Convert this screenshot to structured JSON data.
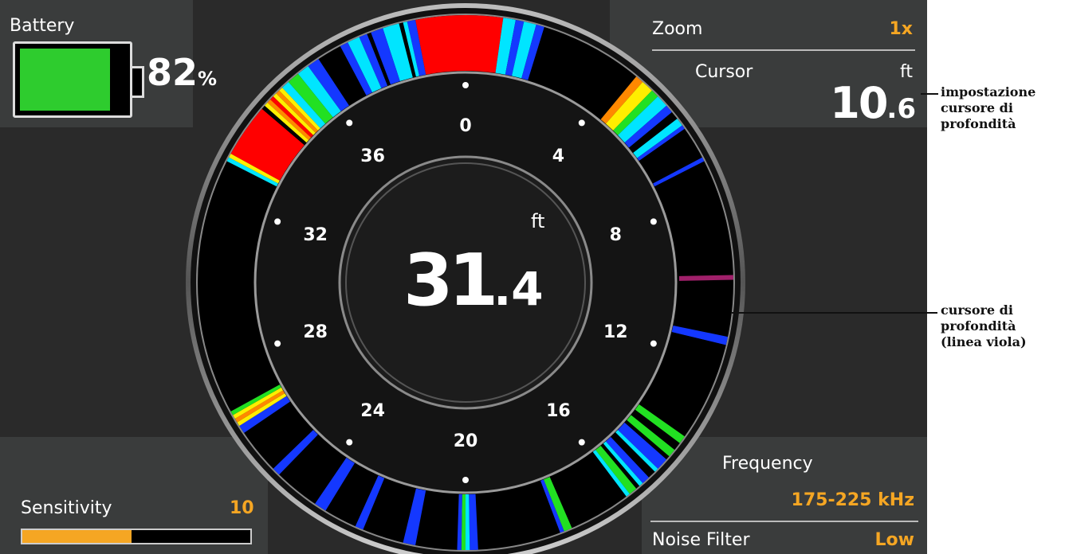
{
  "battery": {
    "label": "Battery",
    "percent": 82,
    "value_text": "82",
    "unit": "%",
    "fill_color": "#2ecc2e"
  },
  "zoom": {
    "label": "Zoom",
    "value": "1x"
  },
  "cursor": {
    "label": "Cursor",
    "unit": "ft",
    "value_int": "10",
    "value_dec": ".6"
  },
  "depth": {
    "unit": "ft",
    "value_int": "31",
    "value_dec": ".4"
  },
  "dial_labels": [
    "0",
    "4",
    "8",
    "12",
    "16",
    "20",
    "24",
    "28",
    "32",
    "36"
  ],
  "sensitivity": {
    "label": "Sensitivity",
    "value": "10",
    "level_fraction": 0.48,
    "bar_color": "#f5a623"
  },
  "frequency": {
    "label": "Frequency",
    "value": "175-225 kHz"
  },
  "noise_filter": {
    "label": "Noise Filter",
    "value": "Low"
  },
  "annotations": {
    "cursor_setting": [
      "impostazione",
      "cursore di",
      "profondità"
    ],
    "cursor_line": [
      "cursore di",
      "profondità",
      "(linea viola)"
    ]
  },
  "colors": {
    "accent": "#f5a623",
    "cursor_line": "#a0206a",
    "background": "#2a2a2a",
    "panel": "#3a3c3c"
  }
}
